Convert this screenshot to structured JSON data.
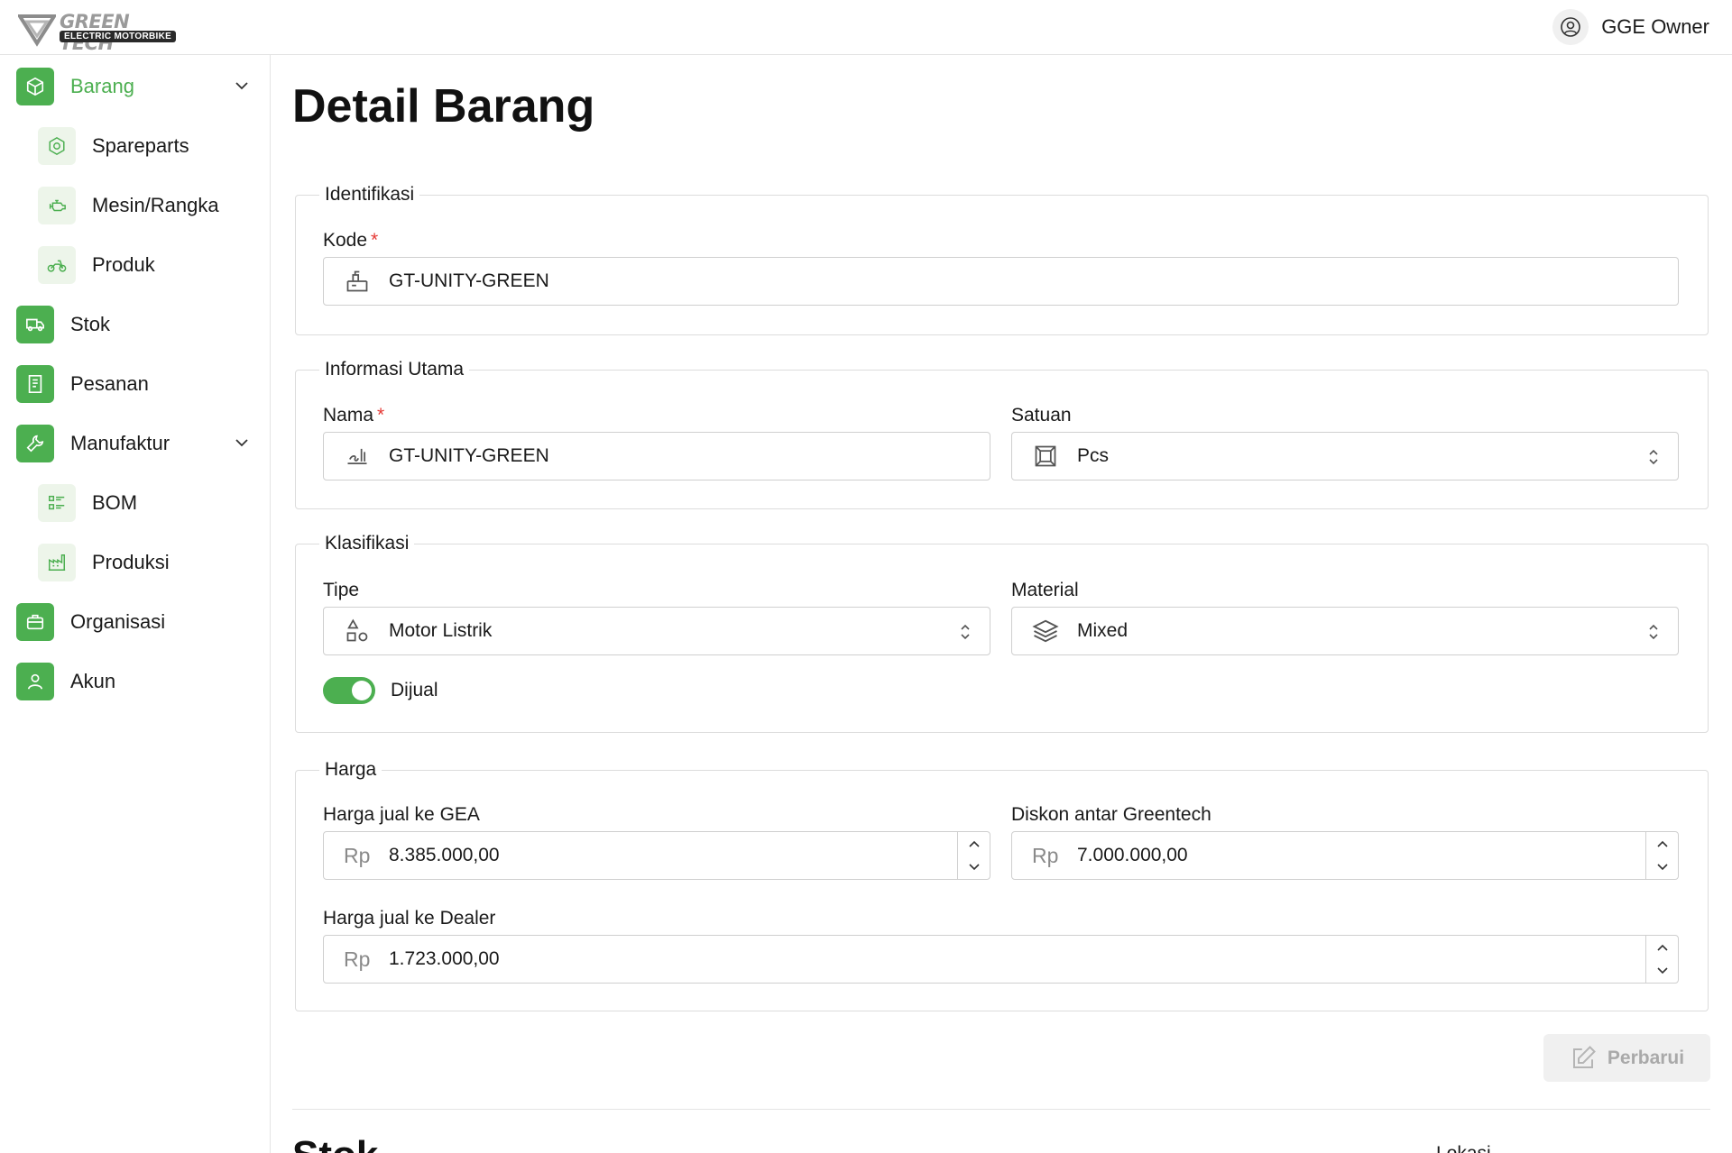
{
  "header": {
    "logo_brand": "GREEN TECH",
    "logo_sub": "ELECTRIC MOTORBIKE",
    "user_name": "GGE Owner"
  },
  "sidebar": {
    "items": [
      {
        "label": "Barang",
        "icon": "box-icon",
        "active": true
      },
      {
        "label": "Spareparts",
        "icon": "nut-icon"
      },
      {
        "label": "Mesin/Rangka",
        "icon": "engine-icon"
      },
      {
        "label": "Produk",
        "icon": "motorbike-icon"
      },
      {
        "label": "Stok",
        "icon": "truck-icon"
      },
      {
        "label": "Pesanan",
        "icon": "receipt-icon"
      },
      {
        "label": "Manufaktur",
        "icon": "wrench-icon"
      },
      {
        "label": "BOM",
        "icon": "list-icon"
      },
      {
        "label": "Produksi",
        "icon": "factory-icon"
      },
      {
        "label": "Organisasi",
        "icon": "briefcase-icon"
      },
      {
        "label": "Akun",
        "icon": "user-icon"
      }
    ]
  },
  "main": {
    "title": "Detail Barang",
    "identifikasi": {
      "legend": "Identifikasi",
      "kode_label": "Kode",
      "kode_required": "*",
      "kode_value": "GT-UNITY-GREEN"
    },
    "informasi_utama": {
      "legend": "Informasi Utama",
      "nama_label": "Nama",
      "nama_required": "*",
      "nama_value": "GT-UNITY-GREEN",
      "satuan_label": "Satuan",
      "satuan_value": "Pcs"
    },
    "klasifikasi": {
      "legend": "Klasifikasi",
      "tipe_label": "Tipe",
      "tipe_value": "Motor Listrik",
      "material_label": "Material",
      "material_value": "Mixed",
      "dijual_label": "Dijual",
      "dijual_on": true
    },
    "harga": {
      "legend": "Harga",
      "currency": "Rp",
      "gea_label": "Harga jual ke GEA",
      "gea_value": "8.385.000,00",
      "diskon_label": "Diskon antar Greentech",
      "diskon_value": "7.000.000,00",
      "dealer_label": "Harga jual ke Dealer",
      "dealer_value": "1.723.000,00"
    },
    "update_button": "Perbarui",
    "next_section_title": "Stok",
    "next_section_column": "Lokasi"
  },
  "colors": {
    "accent": "#4caf50",
    "accent_light": "#edf5ea",
    "required": "#e53935"
  }
}
